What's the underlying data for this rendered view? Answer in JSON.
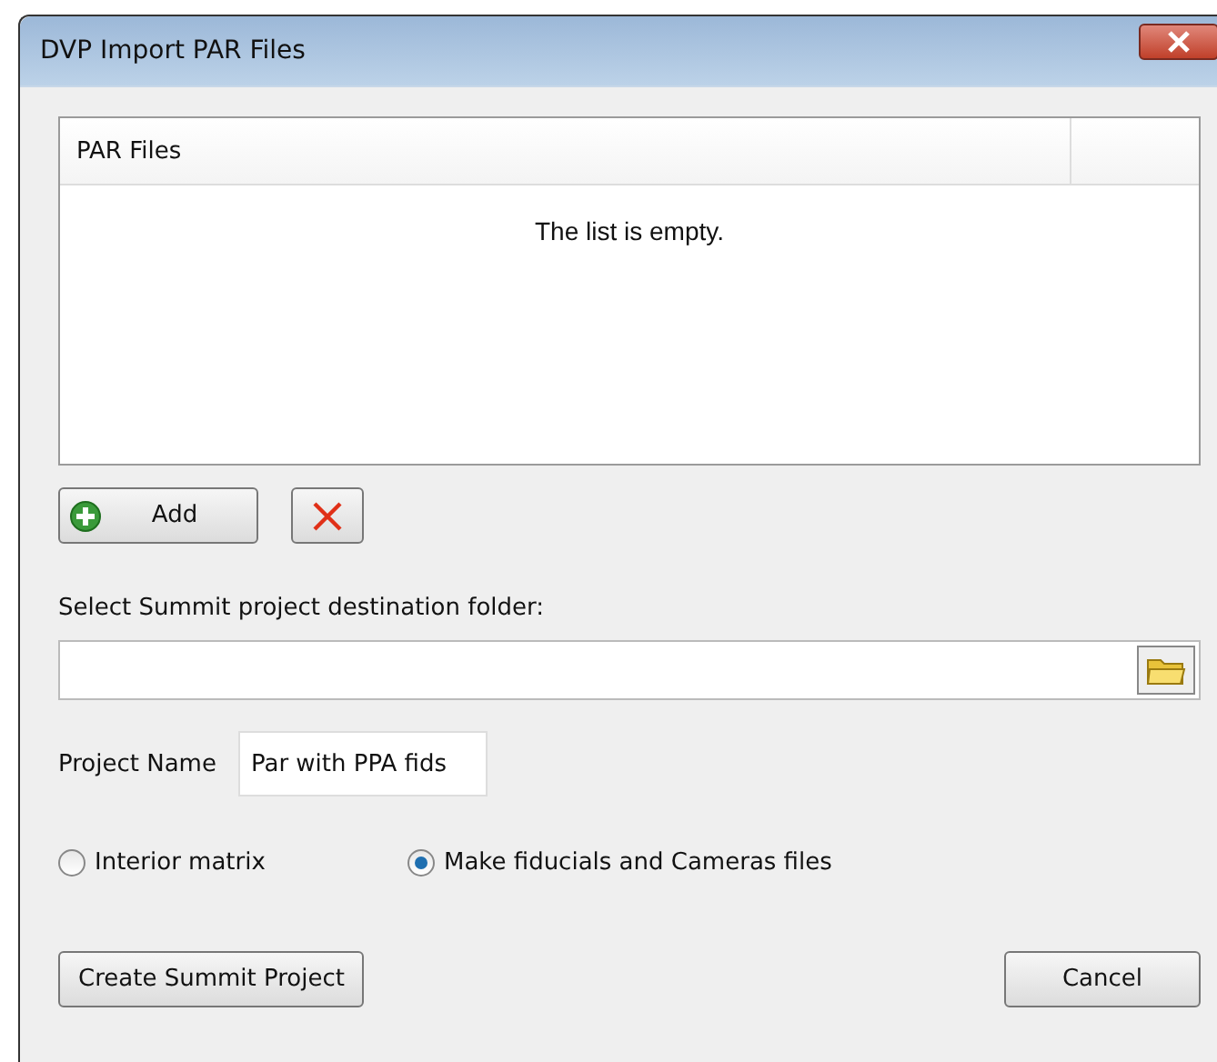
{
  "window": {
    "title": "DVP Import PAR Files"
  },
  "list": {
    "columns": [
      "PAR Files"
    ],
    "empty_text": "The list is empty."
  },
  "add_button": {
    "label": "Add"
  },
  "folder": {
    "label": "Select Summit project destination folder:"
  },
  "project_name": {
    "label": "Project Name",
    "value": "Par with PPA fids"
  },
  "options": [
    {
      "label": "Interior matrix",
      "selected": false
    },
    {
      "label": "Make fiducials and Cameras files",
      "selected": true
    }
  ],
  "buttons": [
    {
      "label": "Create Summit Project"
    },
    {
      "label": "Cancel"
    }
  ]
}
